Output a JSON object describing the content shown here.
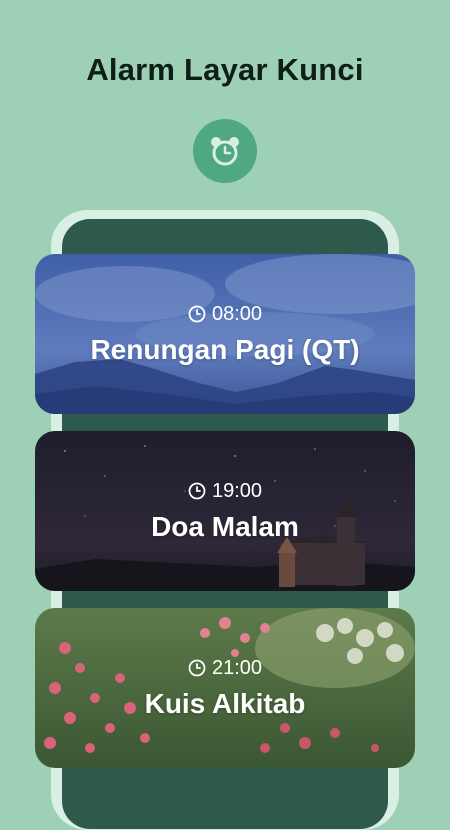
{
  "header": {
    "title": "Alarm Layar Kunci",
    "icon": "alarm-clock-icon"
  },
  "alarms": [
    {
      "time": "08:00",
      "label": "Renungan Pagi (QT)",
      "icon": "clock-icon"
    },
    {
      "time": "19:00",
      "label": "Doa Malam",
      "icon": "clock-icon"
    },
    {
      "time": "21:00",
      "label": "Kuis Alkitab",
      "icon": "clock-icon"
    }
  ],
  "colors": {
    "background": "#9dd0b4",
    "accent": "#4fa882",
    "phone_screen": "#2d5a4c",
    "phone_frame": "#d9efe4",
    "title_text": "#0d1f17"
  }
}
